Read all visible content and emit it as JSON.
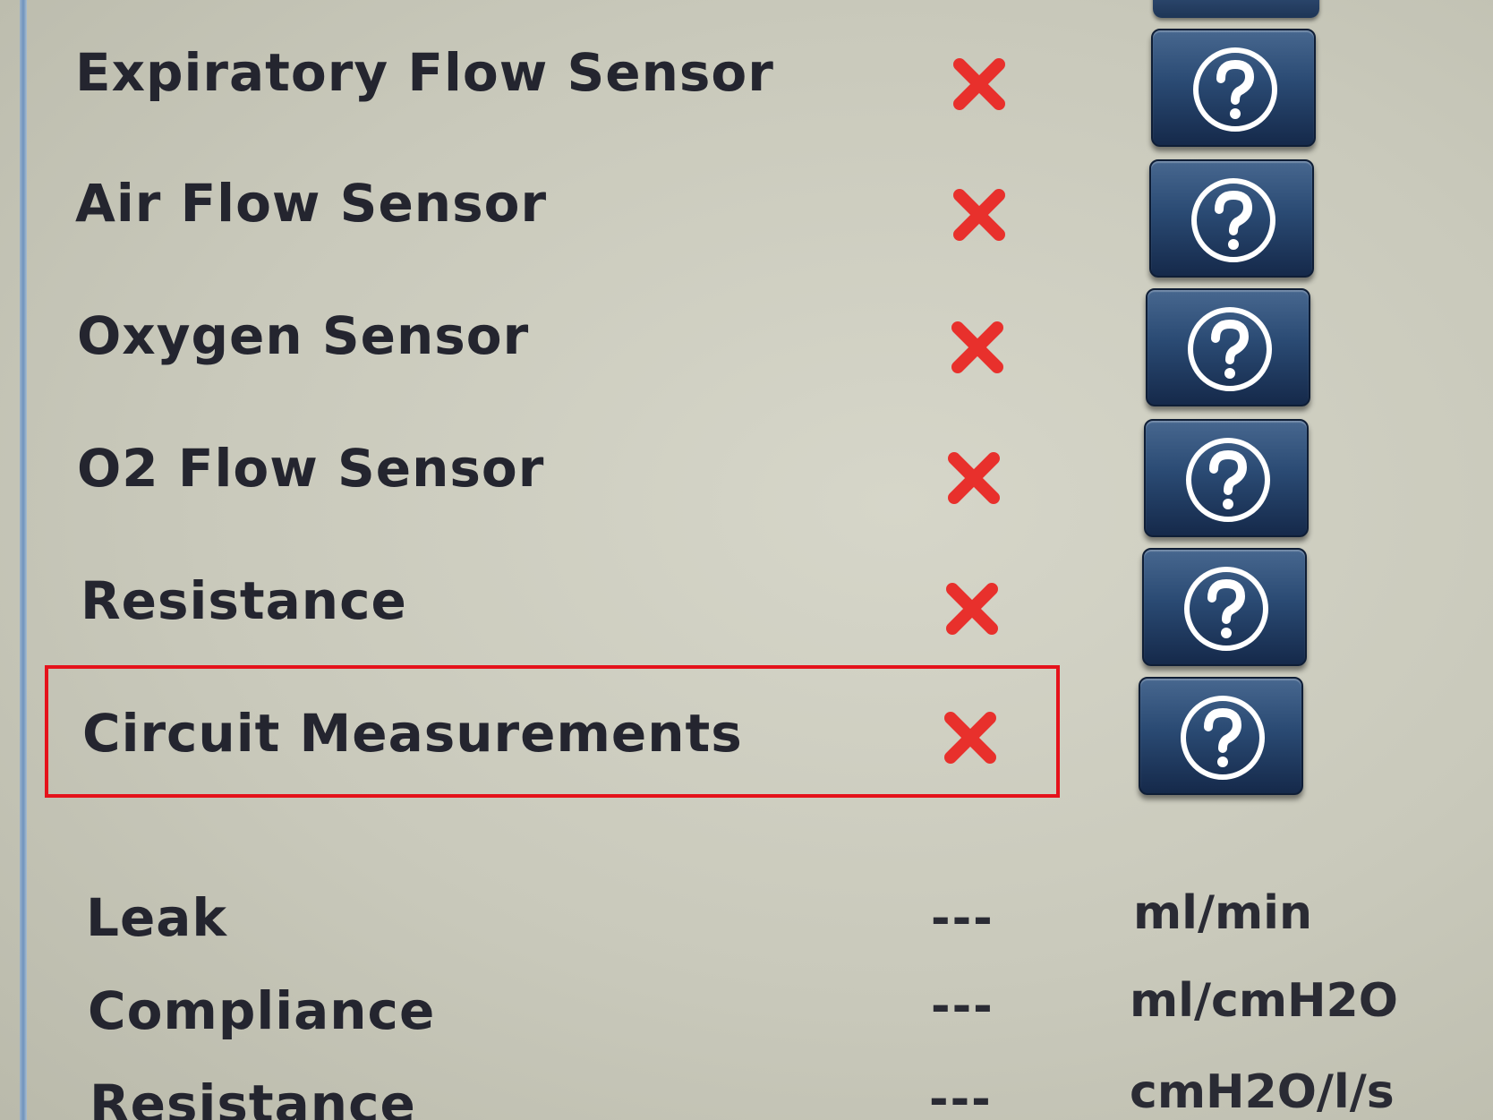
{
  "sensors": [
    {
      "label": "Expiratory Flow Sensor",
      "status_icon": "red-x-icon",
      "status": "fail",
      "help_icon": "question-mark-icon"
    },
    {
      "label": "Air Flow Sensor",
      "status_icon": "red-x-icon",
      "status": "fail",
      "help_icon": "question-mark-icon"
    },
    {
      "label": "Oxygen Sensor",
      "status_icon": "red-x-icon",
      "status": "fail",
      "help_icon": "question-mark-icon"
    },
    {
      "label": "O2 Flow Sensor",
      "status_icon": "red-x-icon",
      "status": "fail",
      "help_icon": "question-mark-icon"
    },
    {
      "label": "Resistance",
      "status_icon": "red-x-icon",
      "status": "fail",
      "help_icon": "question-mark-icon"
    },
    {
      "label": "Circuit Measurements",
      "status_icon": "red-x-icon",
      "status": "fail",
      "help_icon": "question-mark-icon",
      "highlighted": true
    }
  ],
  "measurements": [
    {
      "label": "Leak",
      "value": "---",
      "unit": "ml/min"
    },
    {
      "label": "Compliance",
      "value": "---",
      "unit": "ml/cmH2O"
    },
    {
      "label": "Resistance",
      "value": "---",
      "unit": "cmH2O/l/s"
    }
  ],
  "colors": {
    "fail_x": "#e8302c",
    "highlight_border": "#e5121b",
    "help_button": "#2a4a73",
    "background": "#cfcfc2",
    "text": "#24252f"
  }
}
